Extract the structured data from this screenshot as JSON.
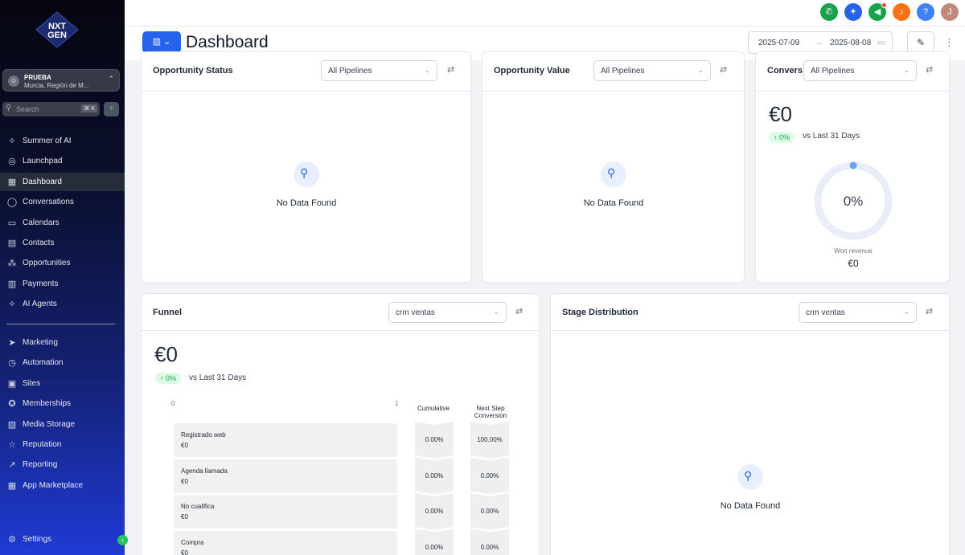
{
  "brand": {
    "logo_line1": "NXT",
    "logo_line2": "GEN"
  },
  "account": {
    "name": "PRUEBA",
    "location": "Murcia, Región de M...",
    "avatar": "☺"
  },
  "search": {
    "placeholder": "Search",
    "shortcut": "⌘ K"
  },
  "nav": {
    "primary": [
      {
        "label": "Summer of AI",
        "icon": "sparkle-icon",
        "glyph": "✧"
      },
      {
        "label": "Launchpad",
        "icon": "rocket-icon",
        "glyph": "◎"
      },
      {
        "label": "Dashboard",
        "icon": "grid-icon",
        "glyph": "▦"
      },
      {
        "label": "Conversations",
        "icon": "chat-icon",
        "glyph": "◯"
      },
      {
        "label": "Calendars",
        "icon": "calendar-icon",
        "glyph": "▭"
      },
      {
        "label": "Contacts",
        "icon": "contacts-icon",
        "glyph": "▤"
      },
      {
        "label": "Opportunities",
        "icon": "opportunities-icon",
        "glyph": "⁂"
      },
      {
        "label": "Payments",
        "icon": "payments-icon",
        "glyph": "▥"
      },
      {
        "label": "AI Agents",
        "icon": "ai-agents-icon",
        "glyph": "✧"
      }
    ],
    "secondary": [
      {
        "label": "Marketing",
        "icon": "send-icon",
        "glyph": "➤"
      },
      {
        "label": "Automation",
        "icon": "automation-icon",
        "glyph": "◷"
      },
      {
        "label": "Sites",
        "icon": "sites-icon",
        "glyph": "▣"
      },
      {
        "label": "Memberships",
        "icon": "membership-icon",
        "glyph": "✪"
      },
      {
        "label": "Media Storage",
        "icon": "media-icon",
        "glyph": "▨"
      },
      {
        "label": "Reputation",
        "icon": "star-icon",
        "glyph": "☆"
      },
      {
        "label": "Reporting",
        "icon": "trend-icon",
        "glyph": "↗"
      },
      {
        "label": "App Marketplace",
        "icon": "apps-icon",
        "glyph": "▦"
      }
    ],
    "settings_label": "Settings",
    "active": "Dashboard"
  },
  "topbar": {
    "user_initial": "J"
  },
  "header": {
    "title": "Dashboard",
    "date_from": "2025-07-09",
    "date_to": "2025-08-08"
  },
  "cards": {
    "opportunity_status": {
      "title": "Opportunity Status",
      "filter": "All Pipelines",
      "empty": "No Data Found"
    },
    "opportunity_value": {
      "title": "Opportunity Value",
      "filter": "All Pipelines",
      "empty": "No Data Found"
    },
    "conversion": {
      "title": "Convers",
      "filter": "All Pipelines",
      "amount": "€0",
      "change": "↑ 0%",
      "vs": "vs Last 31 Days",
      "ring_value": "0%",
      "won_label": "Won revenue",
      "won_value": "€0"
    },
    "funnel": {
      "title": "Funnel",
      "filter": "crm ventas",
      "amount": "€0",
      "change": "↑ 0%",
      "vs": "vs Last 31 Days",
      "axis_min": "0",
      "axis_max": "1",
      "col_cumulative": "Cumulative",
      "col_next": "Next Step Conversion",
      "stages": [
        {
          "name": "Registrado web",
          "value": "€0",
          "cumulative": "0.00%",
          "next": "100.00%"
        },
        {
          "name": "Agenda llamada",
          "value": "€0",
          "cumulative": "0.00%",
          "next": "0.00%"
        },
        {
          "name": "No cualifica",
          "value": "€0",
          "cumulative": "0.00%",
          "next": "0.00%"
        },
        {
          "name": "Compra",
          "value": "€0",
          "cumulative": "0.00%",
          "next": "0.00%"
        }
      ]
    },
    "stage_distribution": {
      "title": "Stage Distribution",
      "filter": "crm ventas",
      "empty": "No Data Found"
    }
  }
}
